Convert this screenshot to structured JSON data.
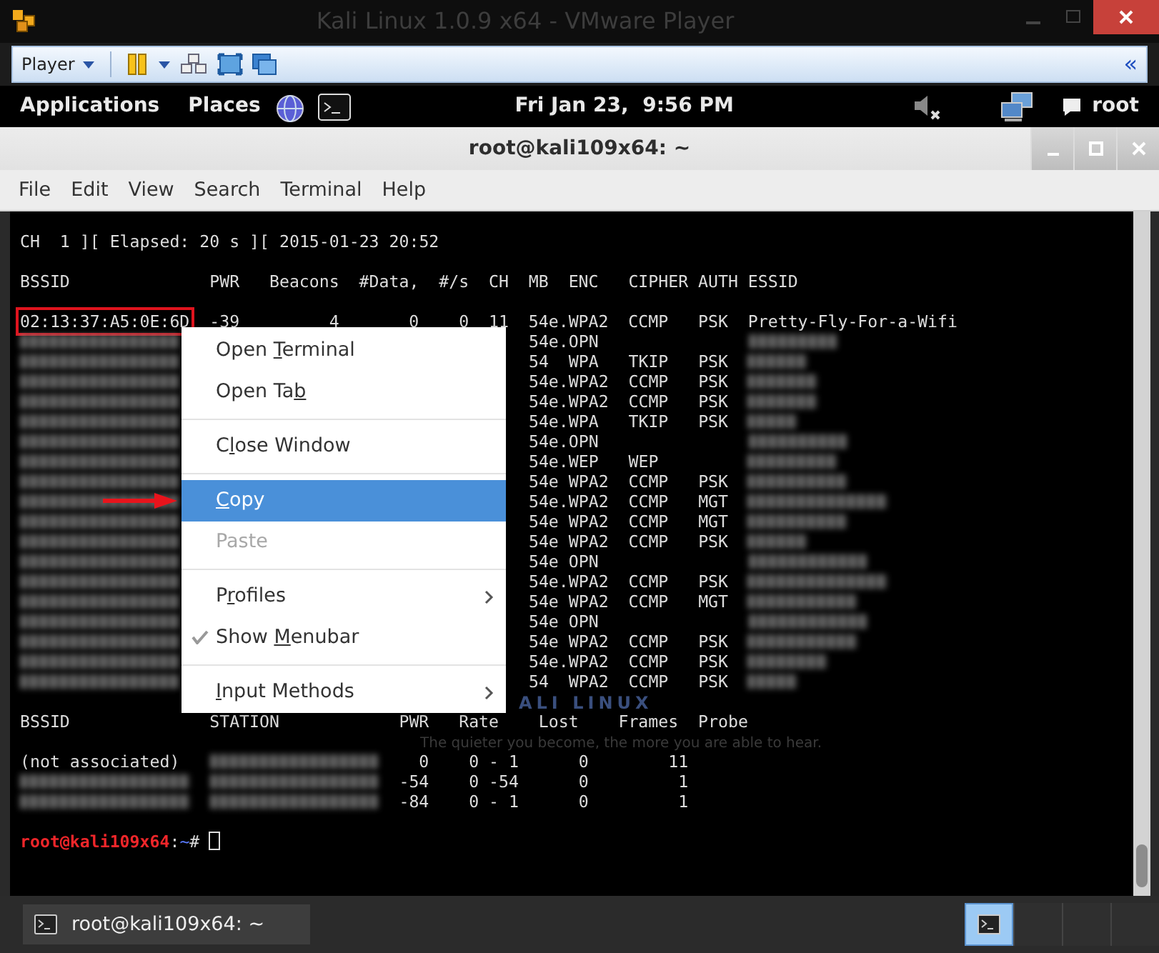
{
  "vm_window": {
    "title": "Kali Linux 1.0.9 x64 - VMware Player"
  },
  "vm_toolbar": {
    "player_menu": "Player",
    "collapse": "«"
  },
  "top_panel": {
    "menus": [
      "Applications",
      "Places"
    ],
    "clock": "Fri Jan 23,  9:56 PM",
    "user": "root",
    "sound_muted": true
  },
  "terminal_window": {
    "title": "root@kali109x64: ~",
    "menubar": [
      "File",
      "Edit",
      "View",
      "Search",
      "Terminal",
      "Help"
    ]
  },
  "terminal": {
    "status_line": "CH  1 ][ Elapsed: 20 s ][ 2015-01-23 20:52",
    "ap_columns": [
      "BSSID",
      "PWR",
      "Beacons",
      "#Data,",
      "#/s",
      "CH",
      "MB",
      "ENC",
      "CIPHER",
      "AUTH",
      "ESSID"
    ],
    "ap_rows": [
      {
        "bssid": "02:13:37:A5:0E:6D",
        "bssid_blurred": false,
        "highlighted": true,
        "pwr": "-39",
        "beacons": "4",
        "data": "0",
        "per_s": "0",
        "ch": "11",
        "mb": "54e.",
        "enc": "WPA2",
        "cipher": "CCMP",
        "auth": "PSK",
        "essid": "Pretty-Fly-For-a-Wifi",
        "essid_blurred": false
      },
      {
        "bssid_blurred": true,
        "highlighted": false,
        "mb": "54e.",
        "enc": "OPN",
        "essid_blurred": true
      },
      {
        "bssid_blurred": true,
        "highlighted": false,
        "mb": "54",
        "enc": "WPA",
        "cipher": "TKIP",
        "auth": "PSK",
        "essid_blurred": true
      },
      {
        "bssid_blurred": true,
        "highlighted": false,
        "mb": "54e.",
        "enc": "WPA2",
        "cipher": "CCMP",
        "auth": "PSK",
        "essid_blurred": true
      },
      {
        "bssid_blurred": true,
        "highlighted": false,
        "mb": "54e.",
        "enc": "WPA2",
        "cipher": "CCMP",
        "auth": "PSK",
        "essid_blurred": true
      },
      {
        "bssid_blurred": true,
        "highlighted": false,
        "mb": "54e.",
        "enc": "WPA",
        "cipher": "TKIP",
        "auth": "PSK",
        "essid_blurred": true
      },
      {
        "bssid_blurred": true,
        "highlighted": false,
        "mb": "54e.",
        "enc": "OPN",
        "essid_blurred": true
      },
      {
        "bssid_blurred": true,
        "highlighted": false,
        "mb": "54e.",
        "enc": "WEP",
        "cipher": "WEP",
        "essid_blurred": true
      },
      {
        "bssid_blurred": true,
        "highlighted": false,
        "mb": "54e",
        "enc": "WPA2",
        "cipher": "CCMP",
        "auth": "PSK",
        "essid_blurred": true
      },
      {
        "bssid_blurred": true,
        "highlighted": false,
        "mb": "54e.",
        "enc": "WPA2",
        "cipher": "CCMP",
        "auth": "MGT",
        "essid_blurred": true
      },
      {
        "bssid_blurred": true,
        "highlighted": false,
        "mb": "54e",
        "enc": "WPA2",
        "cipher": "CCMP",
        "auth": "MGT",
        "essid_blurred": true
      },
      {
        "bssid_blurred": true,
        "highlighted": false,
        "mb": "54e",
        "enc": "WPA2",
        "cipher": "CCMP",
        "auth": "PSK",
        "essid_blurred": true
      },
      {
        "bssid_blurred": true,
        "highlighted": false,
        "mb": "54e",
        "enc": "OPN",
        "essid_blurred": true
      },
      {
        "bssid_blurred": true,
        "highlighted": false,
        "mb": "54e.",
        "enc": "WPA2",
        "cipher": "CCMP",
        "auth": "PSK",
        "essid_blurred": true
      },
      {
        "bssid_blurred": true,
        "highlighted": false,
        "mb": "54e",
        "enc": "WPA2",
        "cipher": "CCMP",
        "auth": "MGT",
        "essid_blurred": true
      },
      {
        "bssid_blurred": true,
        "highlighted": false,
        "mb": "54e",
        "enc": "OPN",
        "essid_blurred": true
      },
      {
        "bssid_blurred": true,
        "highlighted": false,
        "mb": "54e",
        "enc": "WPA2",
        "cipher": "CCMP",
        "auth": "PSK",
        "essid_blurred": true
      },
      {
        "bssid_blurred": true,
        "highlighted": false,
        "mb": "54e.",
        "enc": "WPA2",
        "cipher": "CCMP",
        "auth": "PSK",
        "essid_blurred": true
      },
      {
        "bssid_blurred": true,
        "highlighted": false,
        "mb": "54",
        "enc": "WPA2",
        "cipher": "CCMP",
        "auth": "PSK",
        "essid_blurred": true
      }
    ],
    "station_columns": [
      "BSSID",
      "STATION",
      "PWR",
      "Rate",
      "Lost",
      "Frames",
      "Probe"
    ],
    "station_rows": [
      {
        "bssid": "(not associated)",
        "bssid_blurred": false,
        "station_blurred": true,
        "pwr": "0",
        "rate": "0 - 1",
        "lost": "0",
        "frames": "11"
      },
      {
        "bssid_blurred": true,
        "station_blurred": true,
        "pwr": "-54",
        "rate": "0 -54",
        "lost": "0",
        "frames": "1"
      },
      {
        "bssid_blurred": true,
        "station_blurred": true,
        "pwr": "-84",
        "rate": "0 - 1",
        "lost": "0",
        "frames": "1"
      }
    ],
    "background_logo": "ALI LINUX",
    "background_tagline": "The quieter you become, the more you are able to hear.",
    "prompt": {
      "user_host": "root@kali109x64",
      "separator": ":",
      "path": "~",
      "symbol": "#"
    }
  },
  "context_menu": [
    {
      "kind": "item",
      "label": {
        "before": "Open ",
        "key": "T",
        "after": "erminal"
      },
      "selected": false,
      "disabled": false,
      "checked": false,
      "submenu": false
    },
    {
      "kind": "item",
      "label": {
        "before": "Open Ta",
        "key": "b"
      },
      "selected": false,
      "disabled": false,
      "checked": false,
      "submenu": false
    },
    {
      "kind": "separator"
    },
    {
      "kind": "item",
      "label": {
        "before": "C",
        "key": "l",
        "after": "ose Window"
      },
      "selected": false,
      "disabled": false,
      "checked": false,
      "submenu": false
    },
    {
      "kind": "separator"
    },
    {
      "kind": "item",
      "label": {
        "key": "C",
        "after": "opy"
      },
      "selected": true,
      "disabled": false,
      "checked": false,
      "submenu": false
    },
    {
      "kind": "item",
      "label": {
        "before": "Paste"
      },
      "selected": false,
      "disabled": true,
      "checked": false,
      "submenu": false
    },
    {
      "kind": "separator"
    },
    {
      "kind": "item",
      "label": {
        "before": "P",
        "key": "r",
        "after": "ofiles"
      },
      "selected": false,
      "disabled": false,
      "checked": false,
      "submenu": true
    },
    {
      "kind": "item",
      "label": {
        "before": "Show ",
        "key": "M",
        "after": "enubar"
      },
      "selected": false,
      "disabled": false,
      "checked": true,
      "submenu": false
    },
    {
      "kind": "separator"
    },
    {
      "kind": "item",
      "label": {
        "key": "I",
        "after": "nput Methods"
      },
      "selected": false,
      "disabled": false,
      "checked": false,
      "submenu": true
    }
  ],
  "annotation_arrow": true,
  "bottom_panel": {
    "task": "root@kali109x64: ~",
    "workspaces": [
      {
        "selected": true
      },
      {
        "selected": false
      },
      {
        "selected": false
      },
      {
        "selected": false
      }
    ]
  }
}
